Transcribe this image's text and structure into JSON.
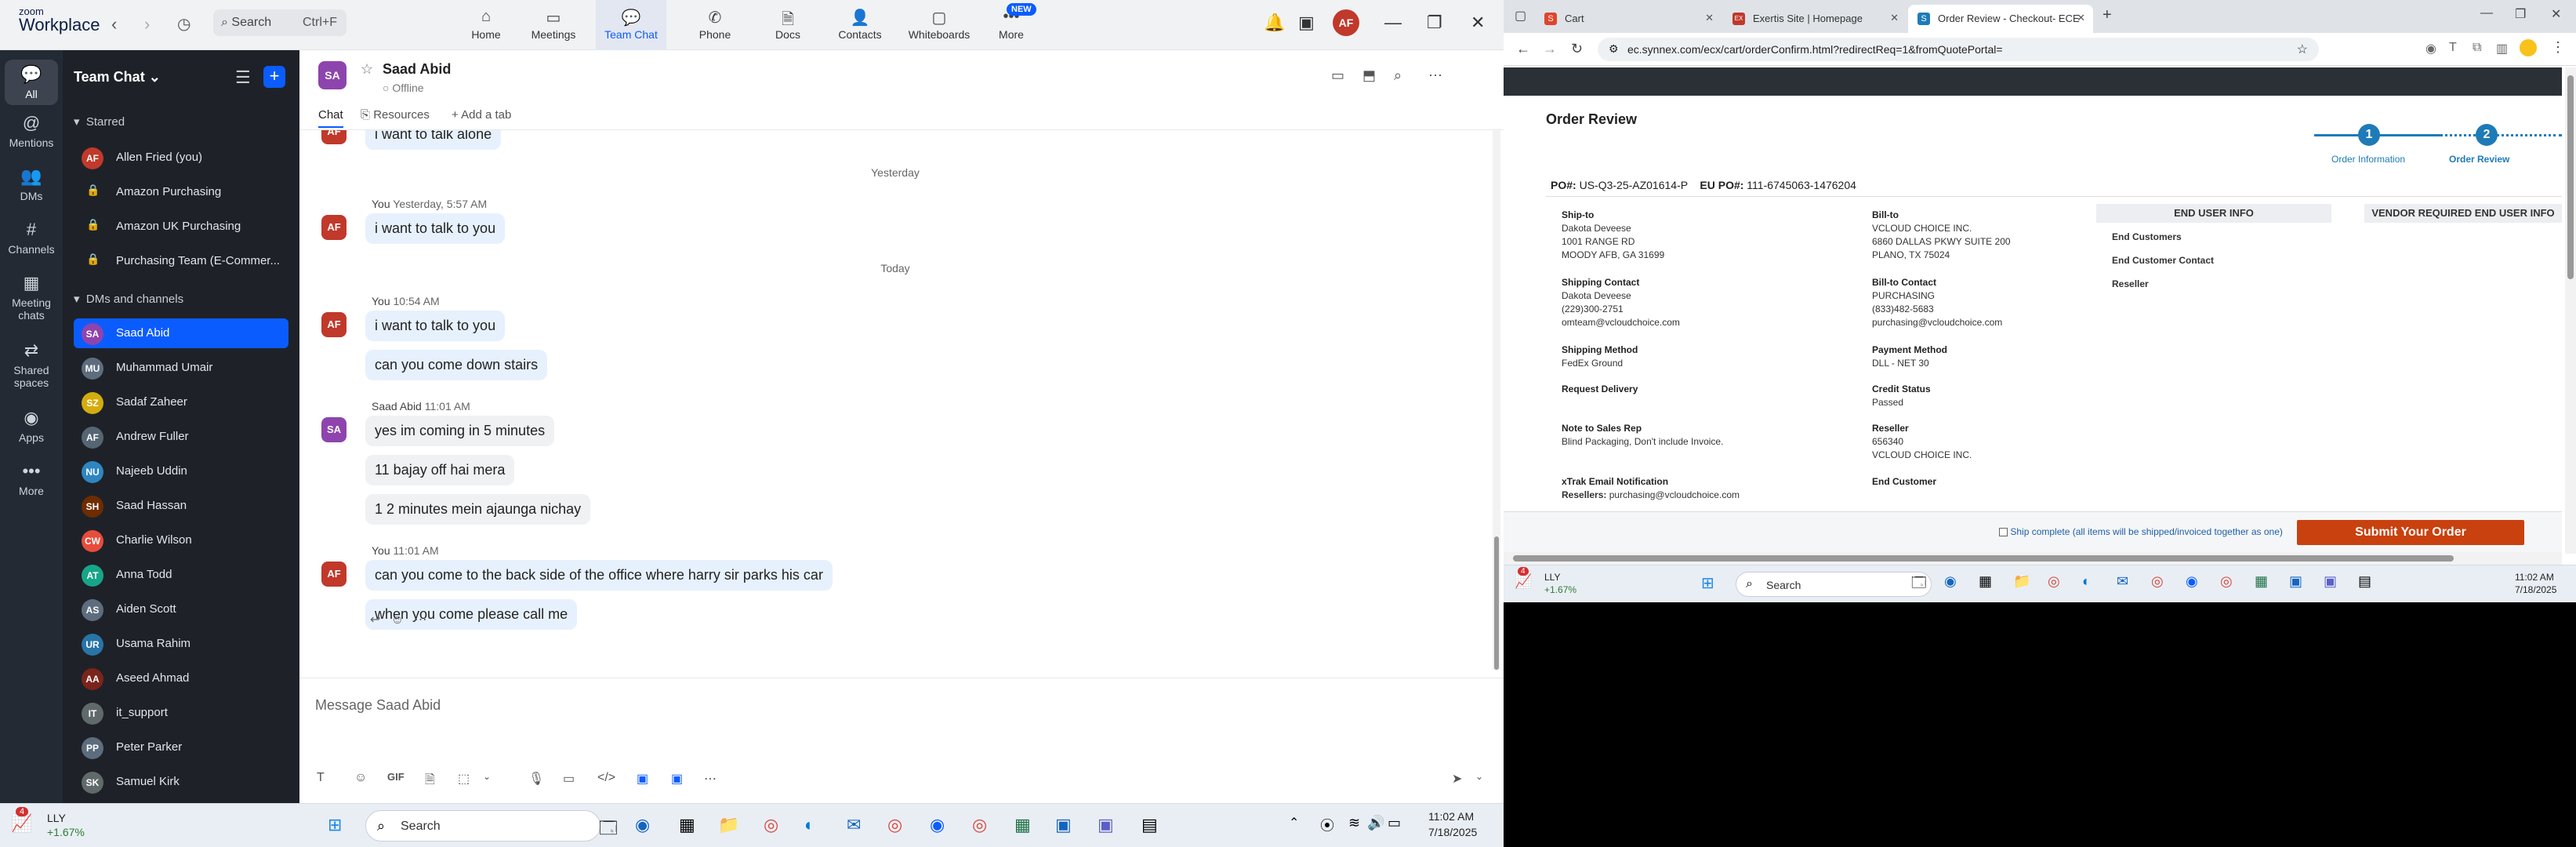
{
  "zoom": {
    "logo_line1": "zoom",
    "logo_line2": "Workplace",
    "search_placeholder": "Search",
    "search_shortcut": "Ctrl+F",
    "nav": [
      {
        "label": "Home",
        "icon": "⌂"
      },
      {
        "label": "Meetings",
        "icon": "▭"
      },
      {
        "label": "Team Chat",
        "icon": "💬"
      },
      {
        "label": "Phone",
        "icon": "✆"
      },
      {
        "label": "Docs",
        "icon": "🗎"
      },
      {
        "label": "Contacts",
        "icon": "👤"
      },
      {
        "label": "Whiteboards",
        "icon": "▢"
      },
      {
        "label": "More",
        "icon": "•••"
      }
    ],
    "new_badge": "NEW",
    "avatar_initials": "AF",
    "rail": [
      {
        "label": "All",
        "icon": "💬"
      },
      {
        "label": "Mentions",
        "icon": "@"
      },
      {
        "label": "DMs",
        "icon": "👥"
      },
      {
        "label": "Channels",
        "icon": "#"
      },
      {
        "label_1": "Meeting",
        "label_2": "chats",
        "icon": "▦"
      },
      {
        "label_1": "Shared",
        "label_2": "spaces",
        "icon": "⇄"
      },
      {
        "label": "Apps",
        "icon": "◉"
      },
      {
        "label": "More",
        "icon": "•••"
      }
    ],
    "sidebar": {
      "title": "Team Chat",
      "starred_label": "Starred",
      "starred": [
        {
          "name": "Allen Fried (you)",
          "initials": "AF",
          "color": "#c0392b"
        },
        {
          "name": "Amazon Purchasing"
        },
        {
          "name": "Amazon UK Purchasing"
        },
        {
          "name": "Purchasing Team (E-Commer..."
        }
      ],
      "dms_label": "DMs and channels",
      "dms": [
        {
          "name": "Saad Abid",
          "initials": "SA",
          "color": "#8e44ad"
        },
        {
          "name": "Muhammad Umair",
          "initials": "MU",
          "color": "#5d6d7e"
        },
        {
          "name": "Sadaf Zaheer",
          "initials": "SZ",
          "color": "#d4ac0d"
        },
        {
          "name": "Andrew Fuller",
          "initials": "AF",
          "color": "#566573"
        },
        {
          "name": "Najeeb Uddin",
          "initials": "NU",
          "color": "#2e86c1"
        },
        {
          "name": "Saad Hassan",
          "initials": "SH",
          "color": "#6e2c00"
        },
        {
          "name": "Charlie Wilson",
          "initials": "CW",
          "color": "#e74c3c"
        },
        {
          "name": "Anna Todd",
          "initials": "AT",
          "color": "#17a589"
        },
        {
          "name": "Aiden Scott",
          "initials": "AS",
          "color": "#5d6d7e"
        },
        {
          "name": "Usama Rahim",
          "initials": "UR",
          "color": "#2874a6"
        },
        {
          "name": "Aseed Ahmad",
          "initials": "AA",
          "color": "#7b241c"
        },
        {
          "name": "it_support",
          "initials": "IT",
          "color": "#616a6b"
        },
        {
          "name": "Peter Parker",
          "initials": "PP",
          "color": "#5d6d7e"
        },
        {
          "name": "Samuel Kirk",
          "initials": "SK",
          "color": "#616a6b"
        }
      ]
    },
    "chat": {
      "name": "Saad Abid",
      "initials": "SA",
      "status": "Offline",
      "tabs": [
        "Chat",
        "Resources",
        "+ Add a tab"
      ],
      "messages": {
        "m0": "i want to talk alone",
        "sep_yesterday": "Yesterday",
        "meta1_name": "You",
        "meta1_time": "Yesterday, 5:57 AM",
        "m1": "i want to talk to you",
        "sep_today": "Today",
        "meta2_name": "You",
        "meta2_time": "10:54 AM",
        "m2": "i want to talk to you",
        "m3": "can you come down stairs",
        "meta3_name": "Saad Abid",
        "meta3_time": "11:01 AM",
        "m4": "yes im coming in 5 minutes",
        "m5": "11 bajay off hai mera",
        "m6": "1 2 minutes mein ajaunga nichay",
        "meta4_name": "You",
        "meta4_time": "11:01 AM",
        "m7": "can you come to the back side of the office where harry sir parks his car",
        "m8": "when you come please call me"
      },
      "compose_placeholder": "Message Saad Abid",
      "compose_gif": "GIF"
    },
    "taskbar": {
      "ticker": "LLY",
      "ticker_change": "+1.67%",
      "badge": "4",
      "search": "Search",
      "time": "11:02 AM",
      "date": "7/18/2025"
    }
  },
  "browser": {
    "tabs": [
      {
        "label": "Cart",
        "fav": "S",
        "color": "#e0452b"
      },
      {
        "label": "Exertis Site | Homepage",
        "fav": "EX",
        "color": "#c0392b"
      },
      {
        "label": "Order Review - Checkout- ECE",
        "fav": "S",
        "color": "#1e7bb8"
      }
    ],
    "url": "ec.synnex.com/ecx/cart/orderConfirm.html?redirectReq=1&fromQuotePortal=",
    "order": {
      "title": "Order Review",
      "step1": "1",
      "step1_label": "Order Information",
      "step2": "2",
      "step2_label": "Order Review",
      "po_label": "PO#:",
      "po": "US-Q3-25-AZ01614-P",
      "eu_po_label": "EU PO#:",
      "eu_po": "111-6745063-1476204",
      "ship_to_label": "Ship-to",
      "ship_to": [
        "Dakota Deveese",
        "1001 RANGE RD",
        "MOODY AFB, GA 31699"
      ],
      "shipping_contact_label": "Shipping Contact",
      "shipping_contact": [
        "Dakota Deveese",
        "(229)300-2751",
        "omteam@vcloudchoice.com"
      ],
      "shipping_method_label": "Shipping Method",
      "shipping_method": "FedEx Ground",
      "request_delivery_label": "Request Delivery",
      "note_label": "Note to Sales Rep",
      "note": "Blind Packaging, Don't include Invoice.",
      "xtrak_label": "xTrak Email Notification",
      "resellers_label": "Resellers:",
      "resellers": "purchasing@vcloudchoice.com",
      "bill_to_label": "Bill-to",
      "bill_to": [
        "VCLOUD CHOICE INC.",
        "6860 DALLAS PKWY SUITE 200",
        "PLANO, TX 75024"
      ],
      "bill_contact_label": "Bill-to Contact",
      "bill_contact": [
        "PURCHASING",
        "(833)482-5683",
        "purchasing@vcloudchoice.com"
      ],
      "payment_label": "Payment Method",
      "payment": "DLL - NET 30",
      "credit_label": "Credit Status",
      "credit": "Passed",
      "reseller_label": "Reseller",
      "reseller": [
        "656340",
        "VCLOUD CHOICE INC."
      ],
      "end_customer_label": "End Customer",
      "end_user_info": "END USER INFO",
      "vendor_info": "VENDOR REQUIRED END USER INFO",
      "end_customers": "End Customers",
      "end_customer_contact": "End Customer Contact",
      "reseller2": "Reseller",
      "ship_complete": "Ship complete (all items will be shipped/invoiced together as one)",
      "submit": "Submit Your Order"
    },
    "taskbar": {
      "ticker": "LLY",
      "ticker_change": "+1.67%",
      "badge": "4",
      "search": "Search",
      "time": "11:02 AM",
      "date": "7/18/2025"
    }
  }
}
